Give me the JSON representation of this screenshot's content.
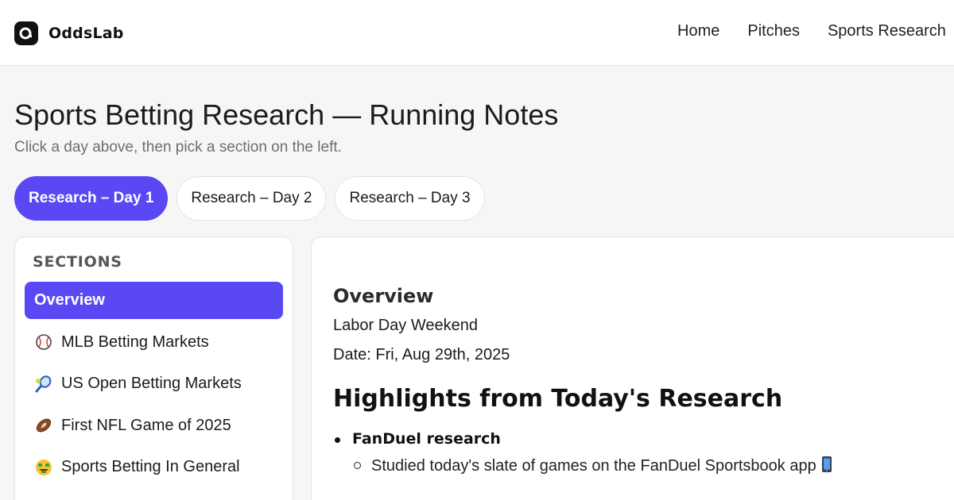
{
  "header": {
    "brand": "OddsLab",
    "nav": [
      "Home",
      "Pitches",
      "Sports Research"
    ]
  },
  "page": {
    "title": "Sports Betting Research — Running Notes",
    "subtitle": "Click a day above, then pick a section on the left."
  },
  "tabs": [
    {
      "label": "Research – Day 1",
      "active": true
    },
    {
      "label": "Research – Day 2",
      "active": false
    },
    {
      "label": "Research – Day 3",
      "active": false
    }
  ],
  "sidebar": {
    "heading": "SECTIONS",
    "items": [
      {
        "label": "Overview",
        "icon": "",
        "active": true
      },
      {
        "label": "MLB Betting Markets",
        "icon": "baseball-icon"
      },
      {
        "label": "US Open Betting Markets",
        "icon": "tennis-racket-icon"
      },
      {
        "label": "First NFL Game of 2025",
        "icon": "football-icon"
      },
      {
        "label": "Sports Betting In General",
        "icon": "money-face-icon"
      }
    ]
  },
  "content": {
    "section_title": "Overview",
    "line1": "Labor Day Weekend",
    "line2": "Date: Fri, Aug 29th, 2025",
    "highlights_heading": "Highlights from Today's Research",
    "bullets": [
      {
        "label": "FanDuel research",
        "sub": [
          "Studied today's slate of games on the FanDuel Sportsbook app"
        ]
      }
    ]
  },
  "colors": {
    "accent": "#5a48f5",
    "background": "#f6f6f7",
    "card": "#ffffff"
  }
}
